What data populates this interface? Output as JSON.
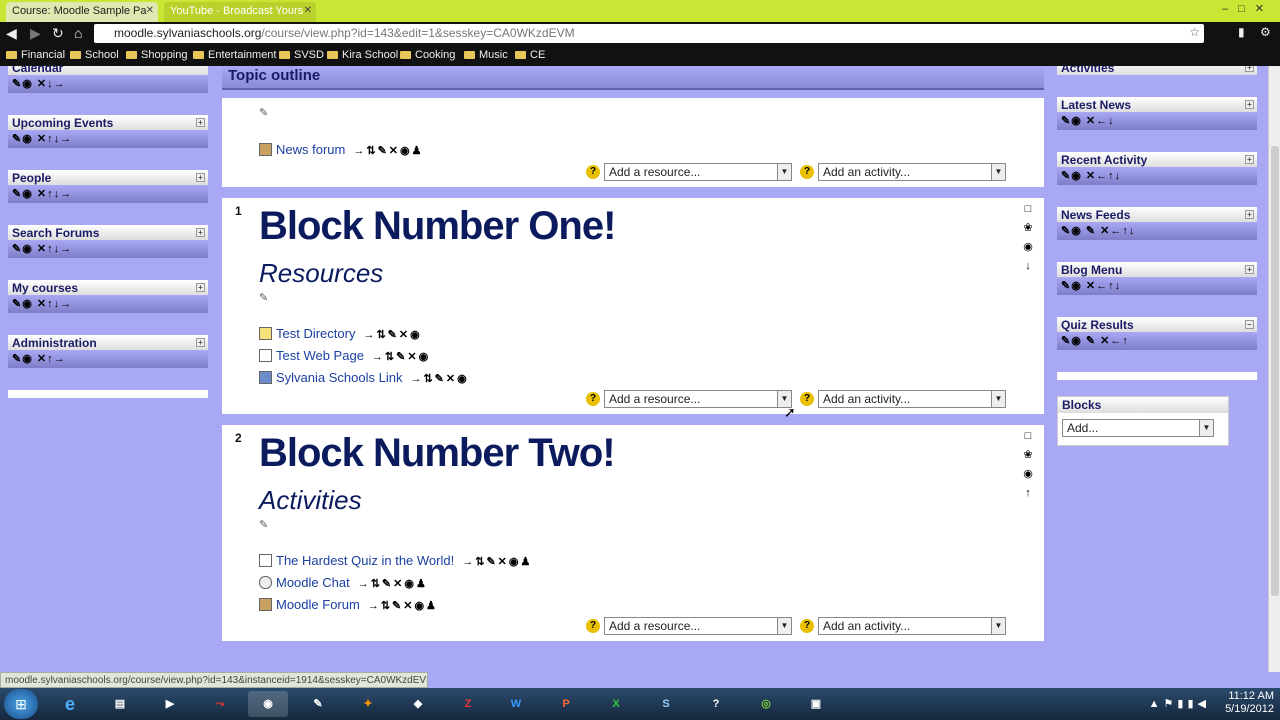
{
  "browser": {
    "tabs": [
      {
        "label": "Course: Moodle Sample Pa"
      },
      {
        "label": "YouTube - Broadcast Yours"
      }
    ],
    "url_host": "moodle.sylvaniaschools.org",
    "url_path": "/course/view.php?id=143&edit=1&sesskey=CA0WKzdEVM",
    "bookmarks": [
      "Financial",
      "School",
      "Shopping",
      "Entertainment",
      "SVSD",
      "Kira School",
      "Cooking",
      "Music",
      "CE"
    ]
  },
  "left_blocks": [
    {
      "title": "Calendar",
      "controls": "✎◉ ✕↓→"
    },
    {
      "title": "Upcoming Events",
      "controls": "✎◉ ✕↑↓→"
    },
    {
      "title": "People",
      "controls": "✎◉ ✕↑↓→"
    },
    {
      "title": "Search Forums",
      "controls": "✎◉ ✕↑↓→"
    },
    {
      "title": "My courses",
      "controls": "✎◉ ✕↑↓→"
    },
    {
      "title": "Administration",
      "controls": "✎◉ ✕↑→"
    }
  ],
  "right_blocks": [
    {
      "title": "Activities"
    },
    {
      "title": "Latest News",
      "controls": "✎◉ ✕←↓"
    },
    {
      "title": "Recent Activity",
      "controls": "✎◉ ✕←↑↓"
    },
    {
      "title": "News Feeds",
      "controls": "✎◉ ✎ ✕←↑↓"
    },
    {
      "title": "Blog Menu",
      "controls": "✎◉ ✕←↑↓"
    },
    {
      "title": "Quiz Results",
      "controls": "✎◉ ✎ ✕←↑"
    }
  ],
  "blocks_panel": {
    "title": "Blocks",
    "select_value": "Add..."
  },
  "topic_outline": {
    "title": "Topic outline"
  },
  "sections": [
    {
      "number": "",
      "items": [
        {
          "label": "News forum",
          "controls": "→⇅✎✕◉♟"
        }
      ],
      "add_resource": "Add a resource...",
      "add_activity": "Add an activity..."
    },
    {
      "number": "1",
      "title": "Block Number One!",
      "subtitle": "Resources",
      "items": [
        {
          "label": "Test Directory",
          "controls": "→⇅✎✕◉"
        },
        {
          "label": "Test Web Page",
          "controls": "→⇅✎✕◉"
        },
        {
          "label": "Sylvania Schools Link",
          "controls": "→⇅✎✕◉"
        }
      ],
      "add_resource": "Add a resource...",
      "add_activity": "Add an activity...",
      "side_icons": [
        "□",
        "❀",
        "◉",
        "↓"
      ]
    },
    {
      "number": "2",
      "title": "Block Number Two!",
      "subtitle": "Activities",
      "items": [
        {
          "label": "The Hardest Quiz in the World!",
          "controls": "→⇅✎✕◉♟"
        },
        {
          "label": "Moodle Chat",
          "controls": "→⇅✎✕◉♟"
        },
        {
          "label": "Moodle Forum",
          "controls": "→⇅✎✕◉♟"
        }
      ],
      "add_resource": "Add a resource...",
      "add_activity": "Add an activity...",
      "side_icons": [
        "□",
        "❀",
        "◉",
        "↑"
      ]
    }
  ],
  "statusbar": "moodle.sylvaniaschools.org/course/view.php?id=143&instanceid=1914&sesskey=CA0WKzdEVM...",
  "taskbar": {
    "time": "11:12 AM",
    "date": "5/19/2012"
  }
}
